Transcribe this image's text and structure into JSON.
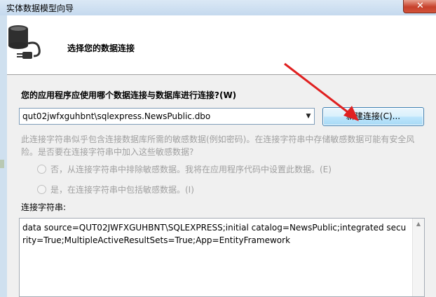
{
  "window": {
    "title": "实体数据模型向导",
    "close_glyph": "✕"
  },
  "header": {
    "title": "选择您的数据连接",
    "icon": "database-plug-icon"
  },
  "main": {
    "question": "您的应用程序应使用哪个数据连接与数据库进行连接?(W)",
    "connection_select": {
      "value": "qut02jwfxguhbnt\\sqlexpress.NewsPublic.dbo"
    },
    "new_connection_label": "新建连接(C)...",
    "sensitive_note_line1": "此连接字符串似乎包含连接数据库所需的敏感数据(例如密码)。在连接字符串中存储敏感数据可能有安全风",
    "sensitive_note_line2": "险。是否要在连接字符串中加入这些敏感数据?",
    "radio_no": "否，从连接字符串中排除敏感数据。我将在应用程序代码中设置此数据。(E)",
    "radio_yes": "是，在连接字符串中包括敏感数据。(I)",
    "connection_string_label": "连接字符串:",
    "connection_string": "data source=QUT02JWFXGUHBNT\\SQLEXPRESS;initial catalog=NewsPublic;integrated security=True;MultipleActiveResultSets=True;App=EntityFramework"
  },
  "colors": {
    "annotation_arrow": "#e02020",
    "disabled_text": "#a0a0a0"
  }
}
